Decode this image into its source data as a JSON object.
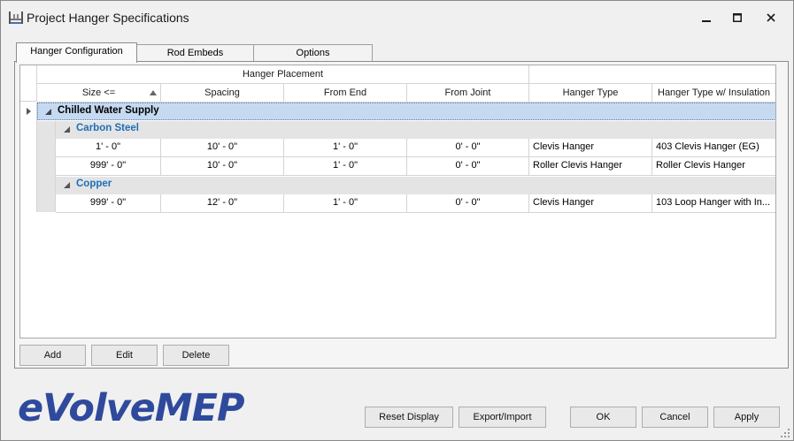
{
  "window": {
    "title": "Project Hanger Specifications"
  },
  "tabs": [
    {
      "label": "Hanger Configuration",
      "active": true
    },
    {
      "label": "Rod Embeds",
      "active": false
    },
    {
      "label": "Options",
      "active": false
    }
  ],
  "grid": {
    "band_header": "Hanger Placement",
    "columns": [
      "Size <=",
      "Spacing",
      "From End",
      "From Joint",
      "Hanger Type",
      "Hanger Type w/ Insulation"
    ],
    "group": {
      "label": "Chilled Water Supply",
      "subgroups": [
        {
          "label": "Carbon Steel",
          "rows": [
            [
              "1' - 0\"",
              "10' - 0\"",
              "1' - 0\"",
              "0' - 0\"",
              "Clevis Hanger",
              "403 Clevis Hanger (EG)"
            ],
            [
              "999' - 0\"",
              "10' - 0\"",
              "1' - 0\"",
              "0' - 0\"",
              "Roller Clevis Hanger",
              "Roller Clevis Hanger"
            ]
          ]
        },
        {
          "label": "Copper",
          "rows": [
            [
              "999' - 0\"",
              "12' - 0\"",
              "1' - 0\"",
              "0' - 0\"",
              "Clevis Hanger",
              "103 Loop Hanger with In..."
            ]
          ]
        }
      ]
    }
  },
  "grid_buttons": {
    "add": "Add",
    "edit": "Edit",
    "delete": "Delete"
  },
  "footer": {
    "logo": "eVolveMEP",
    "reset_display": "Reset Display",
    "export_import": "Export/Import",
    "ok": "OK",
    "cancel": "Cancel",
    "apply": "Apply"
  },
  "colors": {
    "selected_row": "#c5d9f1",
    "subgroup_text": "#1e6fb8",
    "subgroup_bg": "#e4e4e4",
    "logo": "#2f4a9c"
  },
  "icons": [
    "app-hanger-icon",
    "minimize-icon",
    "maximize-icon",
    "close-icon",
    "sort-ascending-icon",
    "collapse-triangle-icon",
    "row-pointer-icon",
    "resize-grip-icon"
  ]
}
